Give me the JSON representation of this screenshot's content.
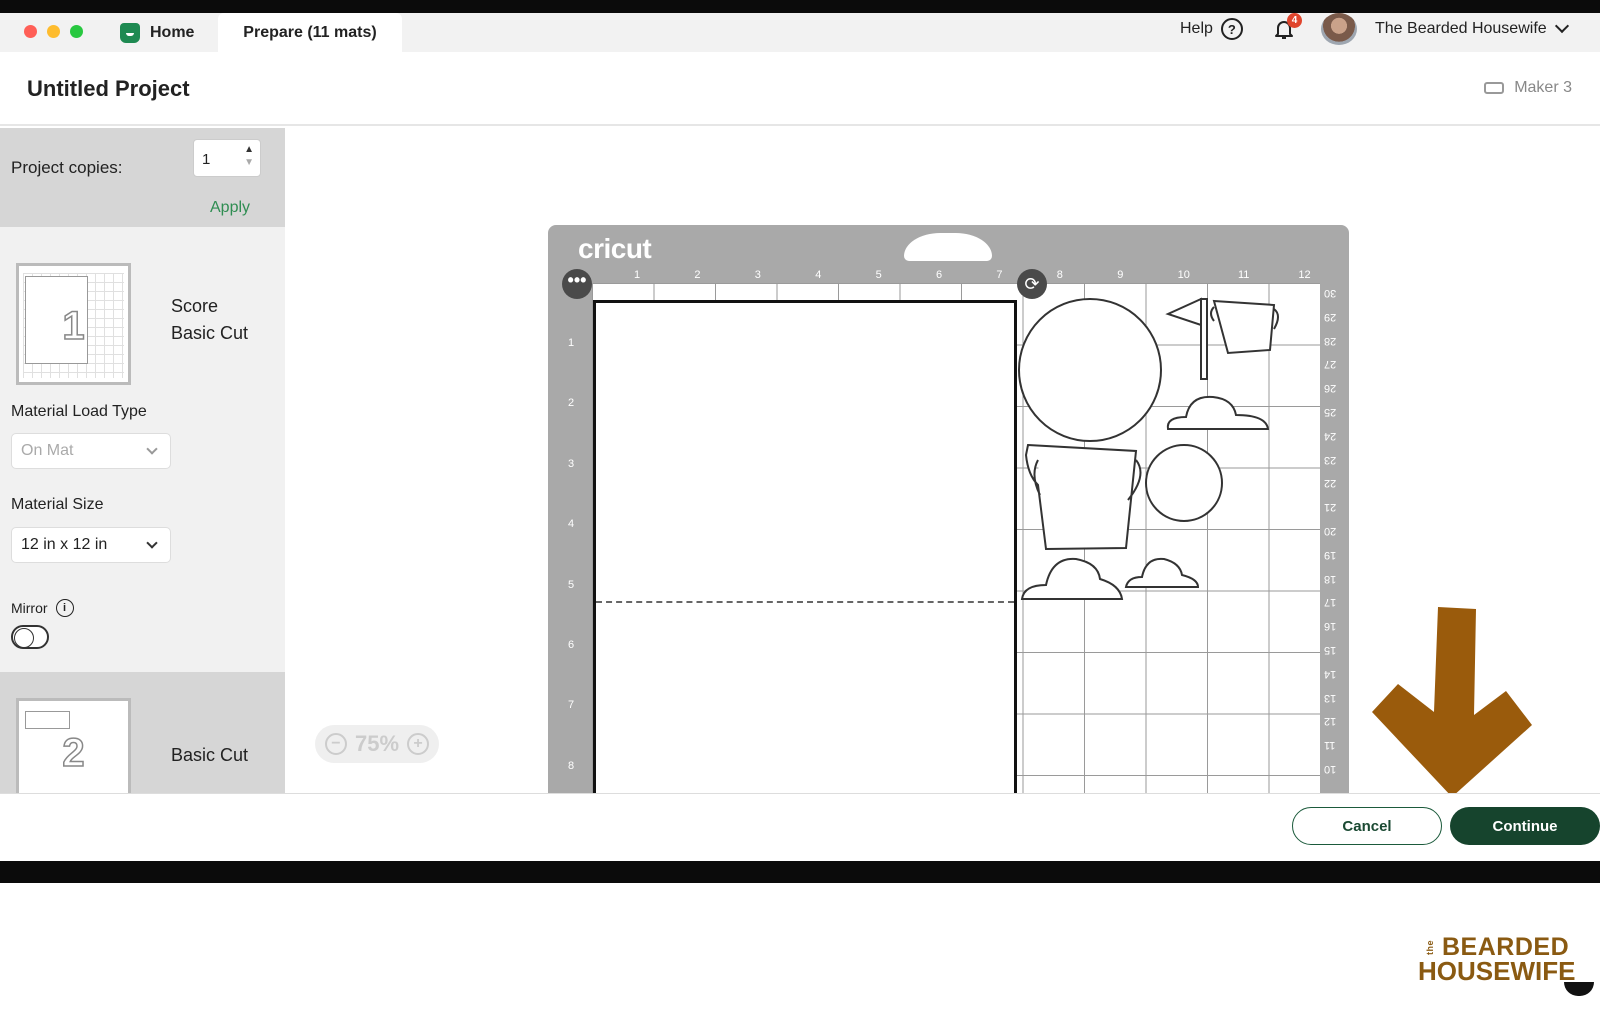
{
  "tabs": {
    "home_label": "Home",
    "prepare_label": "Prepare (11 mats)"
  },
  "topbar": {
    "help_label": "Help",
    "help_glyph": "?",
    "notification_count": "4",
    "username": "The Bearded Housewife"
  },
  "header": {
    "title": "Untitled Project",
    "machine": "Maker 3"
  },
  "sidebar": {
    "copies_label": "Project copies:",
    "copies_value": "1",
    "apply_label": "Apply",
    "mats": [
      {
        "number": "1",
        "line1": "Score",
        "line2": "Basic Cut"
      },
      {
        "number": "2",
        "line1": "Basic Cut"
      }
    ],
    "material_load_type_label": "Material Load Type",
    "material_load_type_value": "On Mat",
    "material_size_label": "Material Size",
    "material_size_value": "12 in x 12 in",
    "mirror_label": "Mirror",
    "mirror_enabled": false
  },
  "canvas": {
    "brand": "cricut",
    "ruler_top": [
      "1",
      "2",
      "3",
      "4",
      "5",
      "6",
      "7",
      "8",
      "9",
      "10",
      "11",
      "12"
    ],
    "ruler_left": [
      "1",
      "2",
      "3",
      "4",
      "5",
      "6",
      "7",
      "8"
    ],
    "ruler_right": [
      "30",
      "29",
      "28",
      "27",
      "26",
      "25",
      "24",
      "23",
      "22",
      "21",
      "20",
      "19",
      "18",
      "17",
      "16",
      "15",
      "14",
      "13",
      "12",
      "11",
      "10"
    ],
    "zoom_level": "75%",
    "zoom_minus": "−",
    "zoom_plus": "+"
  },
  "footer": {
    "cancel_label": "Cancel",
    "continue_label": "Continue"
  },
  "watermark": {
    "the": "the",
    "line1": "BEARDED",
    "line2": "HOUSEWIFE"
  },
  "colors": {
    "accent_green": "#16442d",
    "apply_green": "#2f8d52",
    "arrow_brown": "#9a5b0c",
    "mat_gray": "#a9a9a9"
  }
}
